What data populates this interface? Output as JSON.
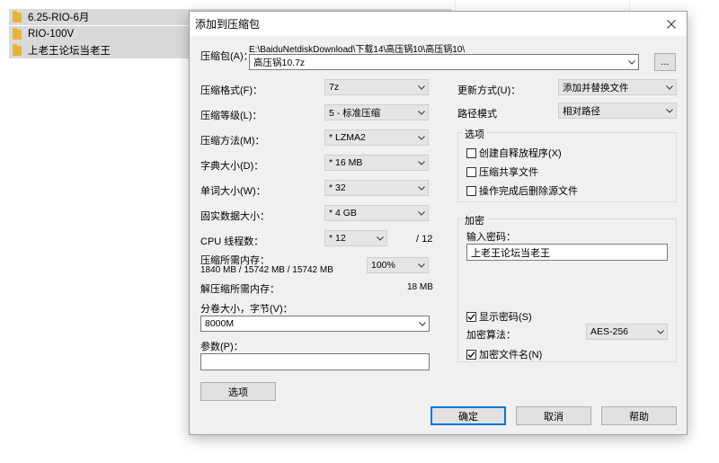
{
  "file_list": {
    "items": [
      {
        "name": "6.25-RIO-6月"
      },
      {
        "name": "RIO-100V"
      },
      {
        "name": "上老王论坛当老王"
      }
    ]
  },
  "dialog": {
    "title": "添加到压缩包",
    "close_icon": "close-icon",
    "archive": {
      "label": "压缩包(A)：",
      "path": "E:\\BaiduNetdiskDownload\\下载14\\高压锅10\\高压锅10\\",
      "filename": "高压锅10.7z",
      "browse_label": "..."
    },
    "format": {
      "label": "压缩格式(F)：",
      "value": "7z"
    },
    "level": {
      "label": "压缩等级(L)：",
      "value": "5 - 标准压缩"
    },
    "method": {
      "label": "压缩方法(M)：",
      "value": "* LZMA2"
    },
    "dict_size": {
      "label": "字典大小(D)：",
      "value": "* 16 MB"
    },
    "word_size": {
      "label": "单词大小(W)：",
      "value": "* 32"
    },
    "solid_block": {
      "label": "固实数据大小：",
      "value": "* 4 GB"
    },
    "cpu_threads": {
      "label": "CPU 线程数：",
      "value": "* 12",
      "max": "/ 12"
    },
    "mem_compress": {
      "label": "压缩所需内存：",
      "detail": "1840 MB / 15742 MB / 15742 MB",
      "value": "100%"
    },
    "mem_decompress": {
      "label": "解压缩所需内存：",
      "value": "18 MB"
    },
    "volume": {
      "label": "分卷大小，字节(V)：",
      "value": "8000M"
    },
    "params": {
      "label": "参数(P)：",
      "value": ""
    },
    "options_button": "选项",
    "update_mode": {
      "label": "更新方式(U)：",
      "value": "添加并替换文件"
    },
    "path_mode": {
      "label": "路径模式",
      "value": "相对路径"
    },
    "options_group": {
      "title": "选项",
      "items": [
        {
          "label": "创建自释放程序(X)",
          "checked": false
        },
        {
          "label": "压缩共享文件",
          "checked": false
        },
        {
          "label": "操作完成后删除源文件",
          "checked": false
        }
      ]
    },
    "encryption": {
      "title": "加密",
      "password_label": "输入密码：",
      "password_value": "上老王论坛当老王",
      "show_password": {
        "label": "显示密码(S)",
        "checked": true
      },
      "algorithm_label": "加密算法：",
      "algorithm_value": "AES-256",
      "encrypt_names": {
        "label": "加密文件名(N)",
        "checked": true
      }
    },
    "buttons": {
      "ok": "确定",
      "cancel": "取消",
      "help": "帮助"
    }
  }
}
